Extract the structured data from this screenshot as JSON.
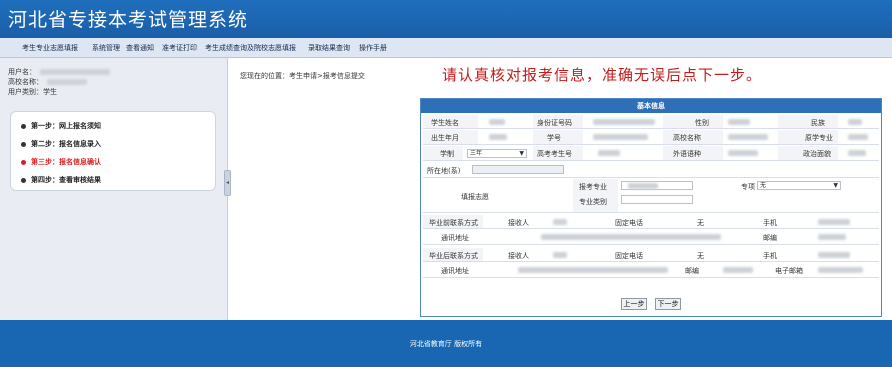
{
  "header": {
    "title": "河北省专接本考试管理系统"
  },
  "nav": {
    "items": [
      "考生专业志愿填报",
      "系统管理",
      "查看通知",
      "准考证打印",
      "考生成绩查询及院校志愿填报",
      "录取结果查询",
      "操作手册"
    ]
  },
  "sidebar": {
    "user_label": "用户名：",
    "school_label": "高校名称：",
    "user_type_label": "用户类别：",
    "user_type_value": "学生",
    "steps": [
      {
        "label": "第一步：网上报名须知",
        "active": false
      },
      {
        "label": "第二步：报名信息录入",
        "active": false
      },
      {
        "label": "第三步：报名信息确认",
        "active": true
      },
      {
        "label": "第四步：查看审核结果",
        "active": false
      }
    ],
    "collapse_glyph": "◂"
  },
  "main": {
    "breadcrumb": "您现在的位置：考生申请>报考信息提交",
    "notice": "请认真核对报考信息，准确无误后点下一步。"
  },
  "form": {
    "header": "基本信息",
    "row1": {
      "name": "学生姓名",
      "id": "身份证号码",
      "gender": "性别",
      "ethnicity": "民族"
    },
    "row2": {
      "birth": "出生年月",
      "student_no": "学号",
      "school": "高校名称",
      "major": "原学专业"
    },
    "row3": {
      "schooling": "学制",
      "schooling_value": "三年",
      "exam_no": "高考考生号",
      "language": "外语语种",
      "politics": "政治面貌"
    },
    "row4": {
      "location": "所在地(系)"
    },
    "row5": {
      "volunteer": "填报志愿",
      "apply_major": "报考专业",
      "category": "专业类别",
      "special": "专项",
      "special_value": "无"
    },
    "contact1": {
      "title": "毕业前联系方式",
      "receiver": "接收人",
      "phone": "固定电话",
      "phone_value": "无",
      "mobile": "手机",
      "address": "通讯地址",
      "postcode": "邮编"
    },
    "contact2": {
      "title": "毕业后联系方式",
      "receiver": "接收人",
      "phone": "固定电话",
      "phone_value": "无",
      "mobile": "手机",
      "address": "通讯地址",
      "postcode": "邮编",
      "email": "电子邮箱"
    },
    "prev_button": "上一步",
    "next_button": "下一步"
  },
  "footer": {
    "text": "河北省教育厅 版权所有"
  },
  "colors": {
    "header_blue": "#1f6fbd",
    "notice_red": "#c41b1b",
    "active_step": "#d81e1e",
    "footer_blue": "#1967b3"
  }
}
